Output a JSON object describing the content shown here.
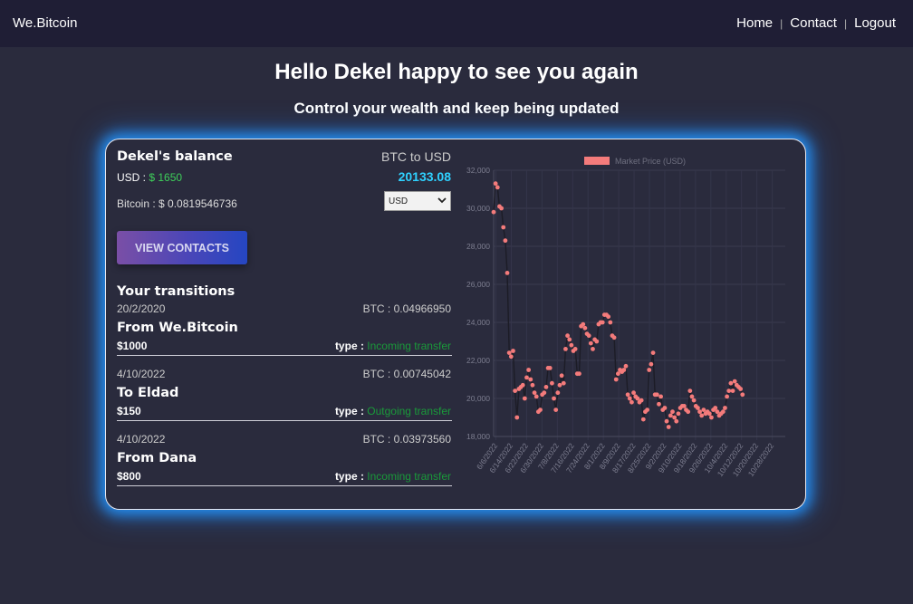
{
  "nav": {
    "brand": "We.Bitcoin",
    "home": "Home",
    "contact": "Contact",
    "logout": "Logout",
    "sep": "|"
  },
  "header": {
    "title": "Hello Dekel happy to see you again",
    "subtitle": "Control your wealth and keep being updated"
  },
  "balance": {
    "title": "Dekel's balance",
    "usd_label": "USD : ",
    "usd_value": "$ 1650",
    "btc_label": "Bitcoin : ",
    "btc_value": "$ 0.0819546736",
    "rate_label": "BTC to USD",
    "rate_value": "20133.08",
    "currency_selected": "USD"
  },
  "view_contacts_label": "VIEW CONTACTS",
  "transitions": {
    "title": "Your transitions",
    "items": [
      {
        "date": "20/2/2020",
        "btc": "BTC : 0.04966950",
        "who": "From We.Bitcoin",
        "amount": "$1000",
        "type_label": "type : ",
        "type": "Incoming transfer"
      },
      {
        "date": "4/10/2022",
        "btc": "BTC : 0.00745042",
        "who": "To Eldad",
        "amount": "$150",
        "type_label": "type : ",
        "type": "Outgoing transfer"
      },
      {
        "date": "4/10/2022",
        "btc": "BTC : 0.03973560",
        "who": "From Dana",
        "amount": "$800",
        "type_label": "type : ",
        "type": "Incoming transfer"
      }
    ]
  },
  "colors": {
    "accent": "#2fd1ff",
    "positive": "#3ecf5a",
    "transfer_type": "#1a9a3a",
    "point": "#f47b7b",
    "glow": "#2396ff"
  },
  "chart_data": {
    "type": "scatter",
    "legend": "Market Price (USD)",
    "legend_position": "top-center",
    "grid": true,
    "ylim": [
      18000,
      32000
    ],
    "y_ticks": [
      "18,000",
      "20,000",
      "22,000",
      "24,000",
      "26,000",
      "28,000",
      "30,000",
      "32,000"
    ],
    "x_ticks": [
      "6/6/2022",
      "6/14/2022",
      "6/22/2022",
      "6/30/2022",
      "7/8/2022",
      "7/16/2022",
      "7/24/2022",
      "8/1/2022",
      "8/9/2022",
      "8/17/2022",
      "8/25/2022",
      "9/2/2022",
      "9/10/2022",
      "9/18/2022",
      "9/26/2022",
      "10/4/2022",
      "10/12/2022",
      "10/20/2022",
      "10/28/2022"
    ],
    "x_range_days": [
      0,
      150
    ],
    "series": [
      {
        "points": [
          [
            0,
            29800
          ],
          [
            1,
            31300
          ],
          [
            2,
            31100
          ],
          [
            3,
            30100
          ],
          [
            4,
            30000
          ],
          [
            5,
            29000
          ],
          [
            6,
            28300
          ],
          [
            7,
            26600
          ],
          [
            8,
            22400
          ],
          [
            9,
            22200
          ],
          [
            10,
            22500
          ],
          [
            11,
            20400
          ],
          [
            12,
            19000
          ],
          [
            13,
            20500
          ],
          [
            14,
            20600
          ],
          [
            15,
            20700
          ],
          [
            16,
            20000
          ],
          [
            17,
            21100
          ],
          [
            18,
            21500
          ],
          [
            19,
            21000
          ],
          [
            20,
            20700
          ],
          [
            21,
            20300
          ],
          [
            22,
            20100
          ],
          [
            23,
            19300
          ],
          [
            24,
            19400
          ],
          [
            25,
            20200
          ],
          [
            26,
            20300
          ],
          [
            27,
            20600
          ],
          [
            28,
            21600
          ],
          [
            29,
            21600
          ],
          [
            30,
            20800
          ],
          [
            31,
            20000
          ],
          [
            32,
            19400
          ],
          [
            33,
            20300
          ],
          [
            34,
            20700
          ],
          [
            35,
            21200
          ],
          [
            36,
            20800
          ],
          [
            37,
            22600
          ],
          [
            38,
            23300
          ],
          [
            39,
            23100
          ],
          [
            40,
            22800
          ],
          [
            41,
            22500
          ],
          [
            42,
            22600
          ],
          [
            43,
            21300
          ],
          [
            44,
            21300
          ],
          [
            45,
            23800
          ],
          [
            46,
            23900
          ],
          [
            47,
            23700
          ],
          [
            48,
            23400
          ],
          [
            49,
            23300
          ],
          [
            50,
            22900
          ],
          [
            51,
            22600
          ],
          [
            52,
            23100
          ],
          [
            53,
            23000
          ],
          [
            54,
            23900
          ],
          [
            55,
            24000
          ],
          [
            56,
            24000
          ],
          [
            57,
            24400
          ],
          [
            58,
            24400
          ],
          [
            59,
            24300
          ],
          [
            60,
            24000
          ],
          [
            61,
            23300
          ],
          [
            62,
            23200
          ],
          [
            63,
            21000
          ],
          [
            64,
            21300
          ],
          [
            65,
            21500
          ],
          [
            66,
            21400
          ],
          [
            67,
            21500
          ],
          [
            68,
            21700
          ],
          [
            69,
            20200
          ],
          [
            70,
            20000
          ],
          [
            71,
            19800
          ],
          [
            72,
            20300
          ],
          [
            73,
            20100
          ],
          [
            74,
            20000
          ],
          [
            75,
            19800
          ],
          [
            76,
            19900
          ],
          [
            77,
            18900
          ],
          [
            78,
            19300
          ],
          [
            79,
            19400
          ],
          [
            80,
            21500
          ],
          [
            81,
            21800
          ],
          [
            82,
            22400
          ],
          [
            83,
            20200
          ],
          [
            84,
            20200
          ],
          [
            85,
            19700
          ],
          [
            86,
            20100
          ],
          [
            87,
            19400
          ],
          [
            88,
            19500
          ],
          [
            89,
            18800
          ],
          [
            90,
            18500
          ],
          [
            91,
            19100
          ],
          [
            92,
            19300
          ],
          [
            93,
            19000
          ],
          [
            94,
            18800
          ],
          [
            95,
            19200
          ],
          [
            96,
            19500
          ],
          [
            97,
            19600
          ],
          [
            98,
            19600
          ],
          [
            99,
            19400
          ],
          [
            100,
            19300
          ],
          [
            101,
            20400
          ],
          [
            102,
            20100
          ],
          [
            103,
            19900
          ],
          [
            104,
            19600
          ],
          [
            105,
            19500
          ],
          [
            106,
            19300
          ],
          [
            107,
            19100
          ],
          [
            108,
            19400
          ],
          [
            109,
            19200
          ],
          [
            110,
            19300
          ],
          [
            111,
            19200
          ],
          [
            112,
            19000
          ],
          [
            113,
            19400
          ],
          [
            114,
            19500
          ],
          [
            115,
            19300
          ],
          [
            116,
            19100
          ],
          [
            117,
            19200
          ],
          [
            118,
            19300
          ],
          [
            119,
            19500
          ],
          [
            120,
            20100
          ],
          [
            121,
            20400
          ],
          [
            122,
            20800
          ],
          [
            123,
            20400
          ],
          [
            124,
            20900
          ],
          [
            125,
            20700
          ],
          [
            126,
            20600
          ],
          [
            127,
            20500
          ],
          [
            128,
            20200
          ]
        ]
      }
    ]
  }
}
